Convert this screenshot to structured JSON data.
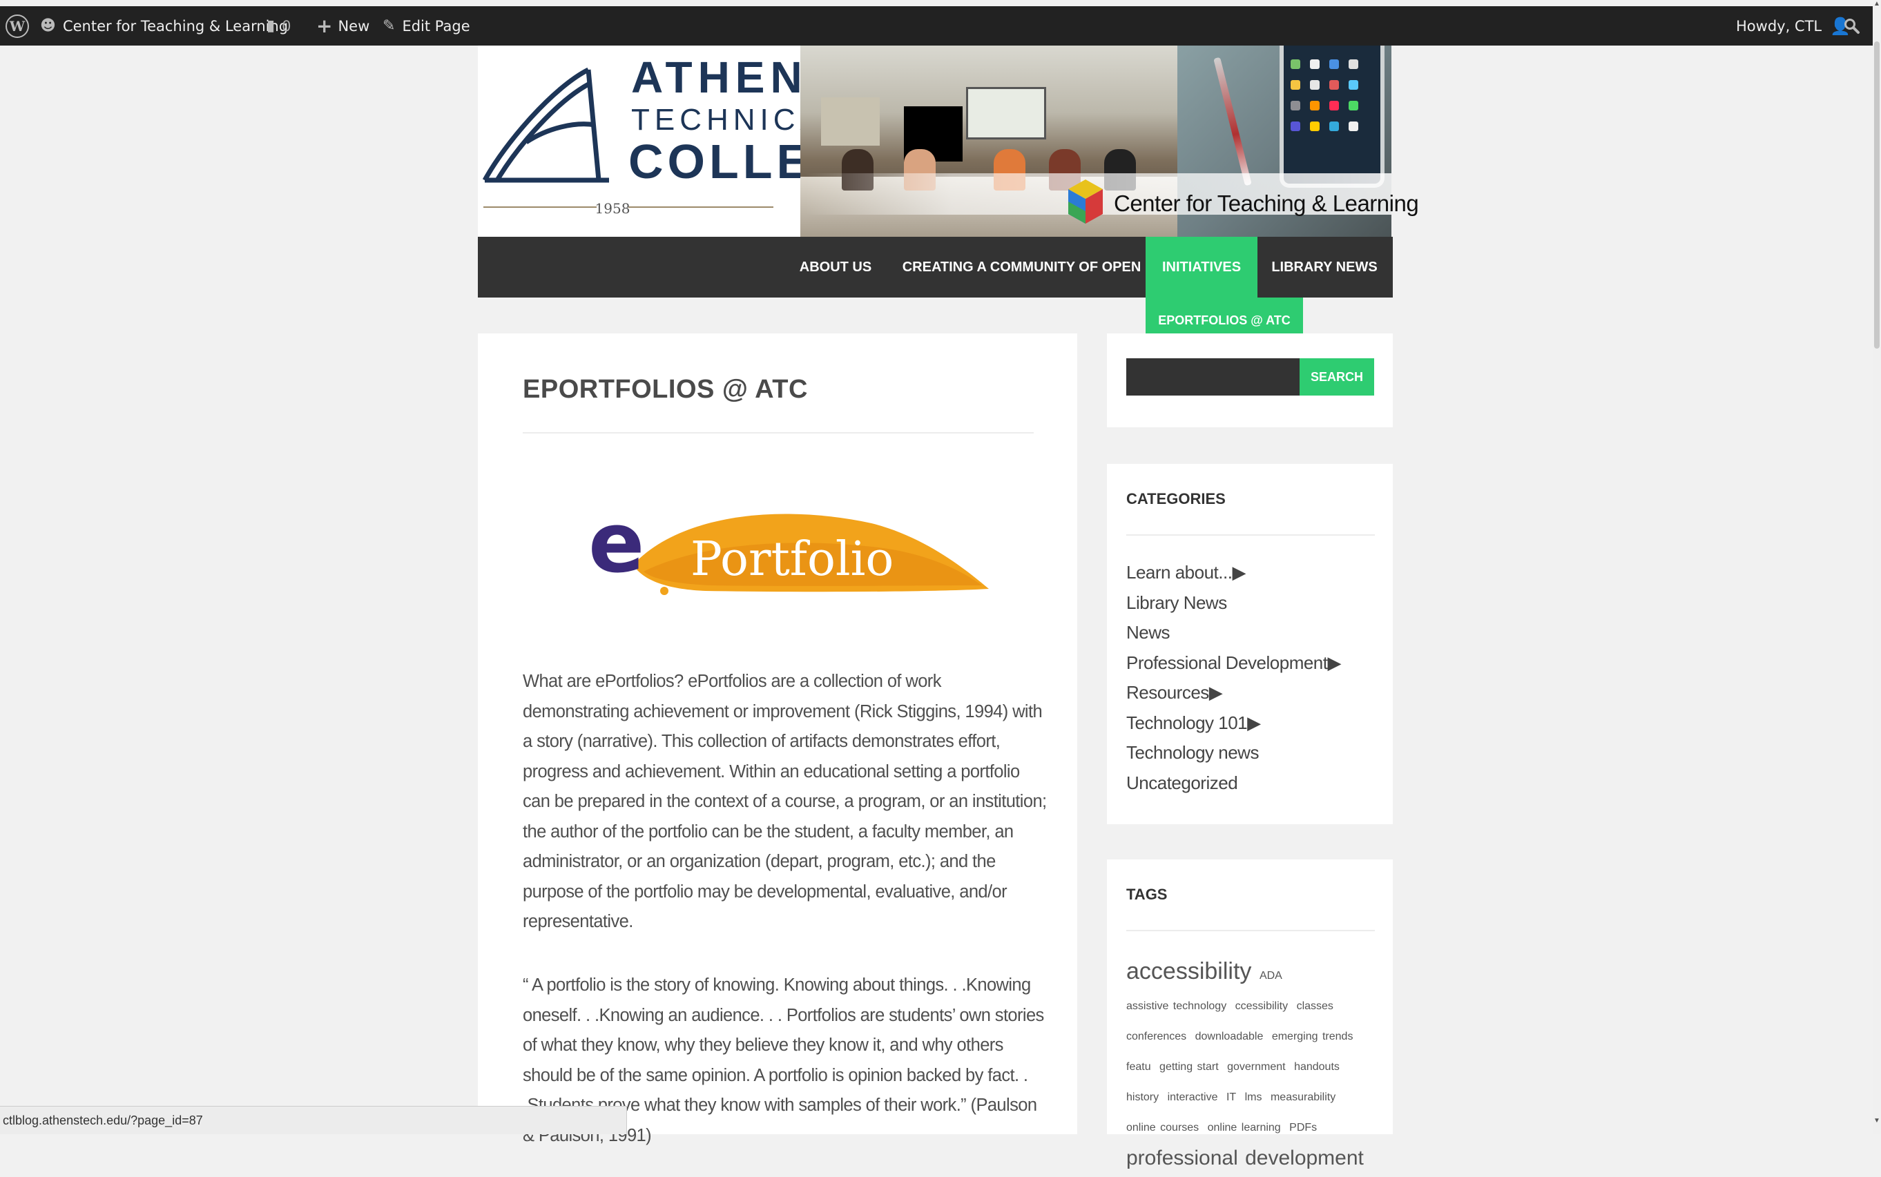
{
  "adminbar": {
    "site_name": "Center for Teaching & Learning",
    "comments_count": "0",
    "new_label": "New",
    "edit_label": "Edit Page",
    "howdy": "Howdy, CTL"
  },
  "header": {
    "college_line1": "ATHENS",
    "college_line2": "TECHNICAL",
    "college_line3": "COLLEGE",
    "year": "1958",
    "banner_title": "Center for Teaching & Learning"
  },
  "nav": {
    "items": [
      {
        "label": "ABOUT US"
      },
      {
        "label": "CREATING A COMMUNITY OF OPEN"
      },
      {
        "label": "INITIATIVES"
      },
      {
        "label": "LIBRARY NEWS"
      }
    ],
    "submenu": [
      "EPORTFOLIOS @ ATC"
    ]
  },
  "page": {
    "title": "EPORTFOLIOS @ ATC",
    "logo_letter": "e",
    "logo_word": "Portfolio",
    "p1": "What are ePortfolios? ePortfolios are a collection of work demonstrating achievement or improvement (Rick Stiggins, 1994) with a story (narrative). This collection of artifacts demonstrates effort, progress and achievement. Within an educational setting a portfolio can be prepared in the context of a course, a program, or an institution; the author of the portfolio can be the student, a faculty member, an administrator, or an organization (depart, program, etc.); and the purpose of the portfolio may be developmental, evaluative, and/or representative.",
    "p2": "“ A portfolio is the story of knowing.  Knowing about things. . .Knowing oneself. . .Knowing an audience. . . Portfolios are students’ own stories of what they know, why they believe they know it, and why others should be of the same opinion.  A portfolio is opinion backed by fact. . .Students prove what they know with samples of their work.” (Paulson & Paulson, 1991)"
  },
  "sidebar": {
    "search_button": "SEARCH",
    "categories_title": "CATEGORIES",
    "categories": [
      "Learn about...▶",
      "Library News",
      "News",
      "Professional Development▶",
      "Resources▶",
      "Technology 101▶",
      "Technology news",
      "Uncategorized"
    ],
    "tags_title": "TAGS",
    "tags": [
      {
        "label": "accessibility",
        "size": 34
      },
      {
        "label": "ADA",
        "size": 16
      },
      {
        "label": "assistive technology",
        "size": 16
      },
      {
        "label": "ccessibility",
        "size": 16
      },
      {
        "label": "classes",
        "size": 16
      },
      {
        "label": "conferences",
        "size": 16
      },
      {
        "label": "downloadable",
        "size": 16
      },
      {
        "label": "emerging trends",
        "size": 16
      },
      {
        "label": "featu",
        "size": 16
      },
      {
        "label": "getting start",
        "size": 16
      },
      {
        "label": "government",
        "size": 16
      },
      {
        "label": "handouts",
        "size": 16
      },
      {
        "label": "history",
        "size": 16
      },
      {
        "label": "interactive",
        "size": 16
      },
      {
        "label": "IT",
        "size": 16
      },
      {
        "label": "lms",
        "size": 16
      },
      {
        "label": "measurability",
        "size": 16
      },
      {
        "label": "online courses",
        "size": 16
      },
      {
        "label": "online learning",
        "size": 16
      },
      {
        "label": "PDFs",
        "size": 16
      },
      {
        "label": "professional development",
        "size": 30
      }
    ]
  },
  "statusbar": {
    "url": "ctlblog.athenstech.edu/?page_id=87"
  },
  "colors": {
    "accent": "#2ecc71",
    "nav_bg": "#333333",
    "adminbar_bg": "#222222",
    "college_navy": "#1d3557",
    "eportfolio_orange": "#f2a31b"
  }
}
